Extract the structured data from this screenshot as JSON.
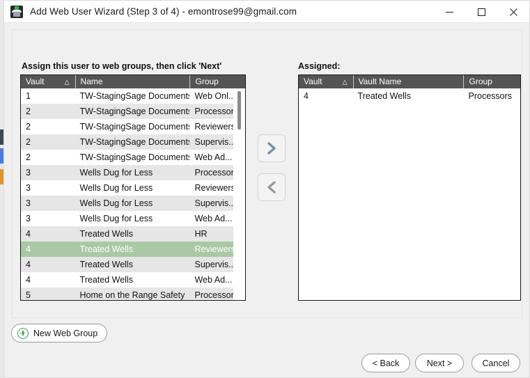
{
  "window": {
    "title": "Add Web User Wizard (Step 3 of 4) - emontrose99@gmail.com",
    "icon": "vault-icon",
    "controls": {
      "minimize": "minimize-icon",
      "maximize": "maximize-icon",
      "close": "close-icon"
    }
  },
  "left_panel": {
    "label": "Assign this user to web groups, then click 'Next'",
    "columns": [
      "Vault",
      "Name",
      "Group"
    ],
    "sort_indicator": "△",
    "rows": [
      {
        "vault": "1",
        "name": "TW-StagingSage Documents",
        "group": "Web Onl...",
        "selected": false
      },
      {
        "vault": "2",
        "name": "TW-StagingSage Documents Test",
        "group": "Processors",
        "selected": false
      },
      {
        "vault": "2",
        "name": "TW-StagingSage Documents Test",
        "group": "Reviewers",
        "selected": false
      },
      {
        "vault": "2",
        "name": "TW-StagingSage Documents Test",
        "group": "Supervis...",
        "selected": false
      },
      {
        "vault": "2",
        "name": "TW-StagingSage Documents Test",
        "group": "Web Ad...",
        "selected": false
      },
      {
        "vault": "3",
        "name": "Wells Dug for Less",
        "group": "Processors",
        "selected": false
      },
      {
        "vault": "3",
        "name": "Wells Dug for Less",
        "group": "Reviewers",
        "selected": false
      },
      {
        "vault": "3",
        "name": "Wells Dug for Less",
        "group": "Supervis...",
        "selected": false
      },
      {
        "vault": "3",
        "name": "Wells Dug for Less",
        "group": "Web Ad...",
        "selected": false
      },
      {
        "vault": "4",
        "name": "Treated Wells",
        "group": "HR",
        "selected": false
      },
      {
        "vault": "4",
        "name": "Treated Wells",
        "group": "Reviewers",
        "selected": true
      },
      {
        "vault": "4",
        "name": "Treated Wells",
        "group": "Supervis...",
        "selected": false
      },
      {
        "vault": "4",
        "name": "Treated Wells",
        "group": "Web Ad...",
        "selected": false
      },
      {
        "vault": "5",
        "name": "Home on the Range Safety",
        "group": "Processors",
        "selected": false
      }
    ]
  },
  "right_panel": {
    "label": "Assigned:",
    "columns": [
      "Vault",
      "Vault Name",
      "Group"
    ],
    "sort_indicator": "△",
    "rows": [
      {
        "vault": "4",
        "name": "Treated Wells",
        "group": "Processors",
        "selected": false
      }
    ]
  },
  "transfer": {
    "add_icon": "chevron-right-icon",
    "remove_icon": "chevron-left-icon"
  },
  "actions": {
    "new_web_group": "New Web Group",
    "back": "< Back",
    "next": "Next >",
    "cancel": "Cancel"
  },
  "colors": {
    "selection_green": "#a9c9a4",
    "header_gray": "#545454",
    "alt_row": "#e6e6e6",
    "accent_green": "#3f9a52",
    "chevron_blue": "#6f93aa",
    "chevron_gray": "#9a9a9a"
  }
}
